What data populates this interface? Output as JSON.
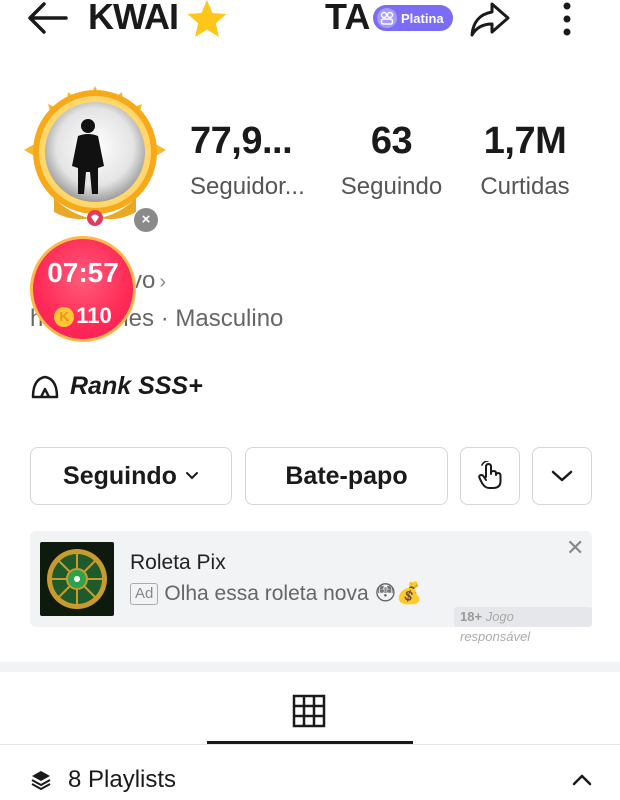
{
  "header": {
    "title_left": "KWAI",
    "title_right": "TA",
    "badge_label": "Platina"
  },
  "stats": [
    {
      "value": "77,9...",
      "label": "Seguidor..."
    },
    {
      "value": "63",
      "label": "Seguindo"
    },
    {
      "value": "1,7M",
      "label": "Curtidas"
    }
  ],
  "bio": {
    "line1": "vo",
    "line2": "h      mimes · Masculino"
  },
  "timer": {
    "time": "07:57",
    "coins": "110"
  },
  "rank": "Rank SSS+",
  "actions": {
    "follow_label": "Seguindo",
    "chat_label": "Bate-papo"
  },
  "ad": {
    "title": "Roleta Pix",
    "tag": "Ad",
    "text": "Olha essa roleta nova 😳💰",
    "responsible_age": "18+",
    "responsible_text": "Jogo responsável"
  },
  "playlists": "8 Playlists",
  "colors": {
    "badge": "#7b6cf6",
    "timer": "#ff2a56",
    "coin": "#ffc534"
  }
}
